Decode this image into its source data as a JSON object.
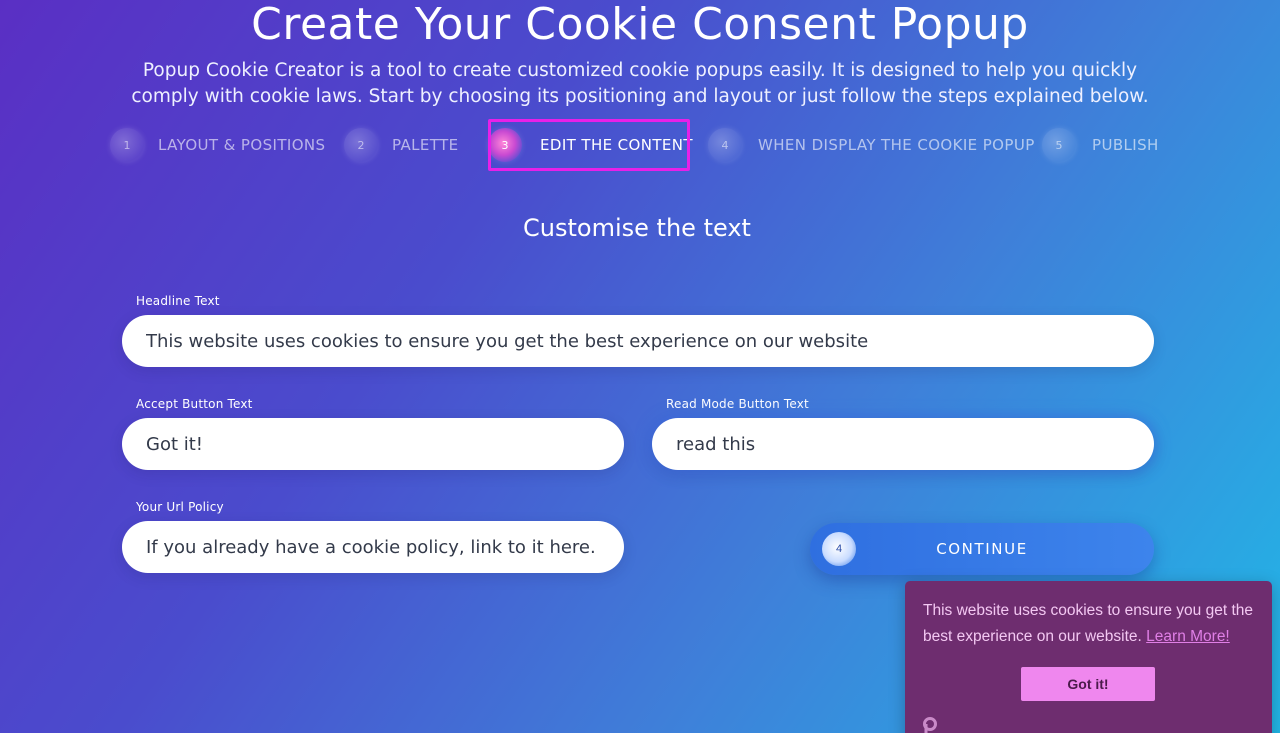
{
  "header": {
    "title": "Create Your Cookie Consent Popup",
    "subtitle": "Popup Cookie Creator is a tool to create customized cookie popups easily. It is designed to help you quickly comply with cookie laws. Start by choosing its positioning and layout or just follow the steps explained below."
  },
  "steps": [
    {
      "num": "1",
      "label": "LAYOUT & POSITIONS",
      "active": false
    },
    {
      "num": "2",
      "label": "PALETTE",
      "active": false
    },
    {
      "num": "3",
      "label": "EDIT THE CONTENT",
      "active": true
    },
    {
      "num": "4",
      "label": "WHEN DISPLAY THE COOKIE POPUP",
      "active": false
    },
    {
      "num": "5",
      "label": "PUBLISH",
      "active": false
    }
  ],
  "section": {
    "title": "Customise the text"
  },
  "form": {
    "headline": {
      "label": "Headline Text",
      "value": "This website uses cookies to ensure you get the best experience on our website"
    },
    "accept": {
      "label": "Accept Button Text",
      "value": "Got it!"
    },
    "read_more": {
      "label": "Read Mode Button Text",
      "value": "read this"
    },
    "policy": {
      "label": "Your Url Policy",
      "placeholder": "If you already have a cookie policy, link to it here."
    },
    "continue": {
      "num": "4",
      "label": "CONTINUE"
    }
  },
  "preview": {
    "message": "This website uses cookies to ensure you get the best experience on our website.",
    "link_label": "Learn More!",
    "button_label": "Got it!",
    "logo_icon": "cookie-logo-icon",
    "colors": {
      "background": "#6e2d6f",
      "text": "#f3c8f2",
      "button": "#ef87ee",
      "link": "#e07fe6"
    }
  },
  "colors": {
    "active_highlight": "#e820e8",
    "continue_button": "#3d84ec"
  }
}
